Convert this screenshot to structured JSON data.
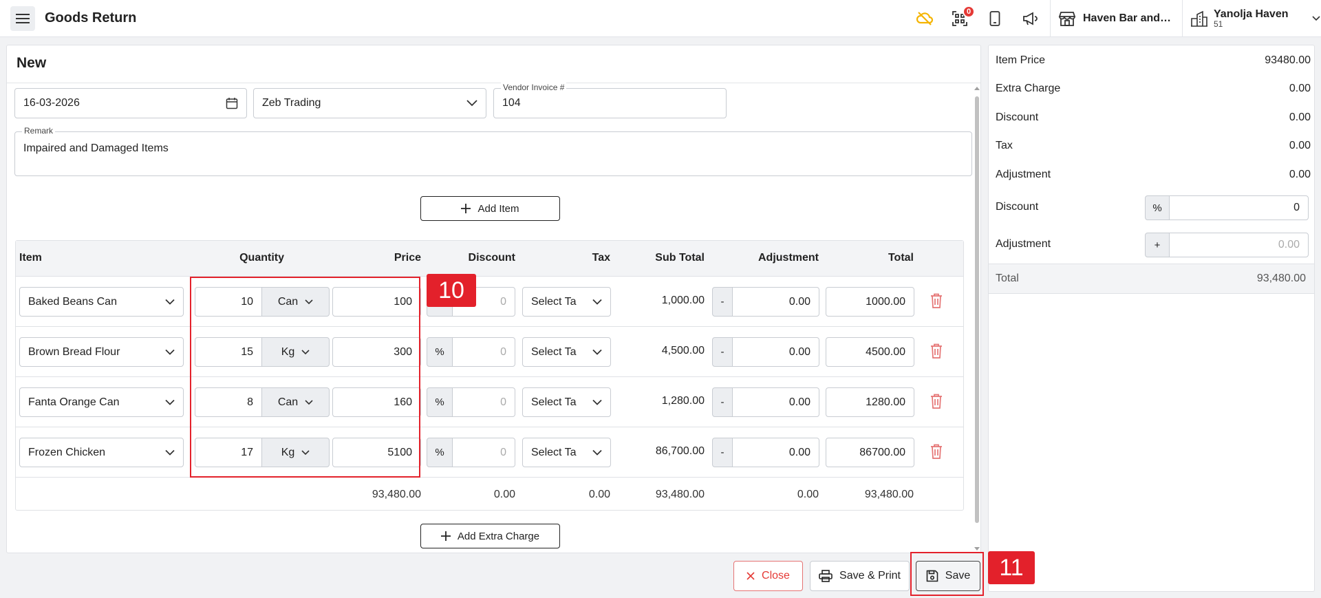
{
  "header": {
    "title": "Goods Return",
    "notification_count": "0",
    "venue_name": "Haven Bar and Restaurant",
    "company_name": "Yanolja Haven",
    "company_id": "51"
  },
  "form": {
    "title": "New",
    "date": "16-03-2026",
    "vendor": "Zeb Trading",
    "vendor_invoice_label": "Vendor Invoice #",
    "vendor_invoice": "104",
    "remark_label": "Remark",
    "remark": "Impaired and Damaged Items",
    "add_item_label": "Add Item",
    "add_extra_charge_label": "Add Extra Charge"
  },
  "table": {
    "headers": {
      "item": "Item",
      "quantity": "Quantity",
      "price": "Price",
      "discount": "Discount",
      "tax": "Tax",
      "sub_total": "Sub Total",
      "adjustment": "Adjustment",
      "total": "Total"
    },
    "rows": [
      {
        "item": "Baked Beans Can",
        "qty": "10",
        "unit": "Can",
        "price": "100",
        "disc_type": "%",
        "discount": "0",
        "tax": "Select Tax",
        "sub_total": "1,000.00",
        "adj_type": "-",
        "adjustment": "0.00",
        "total": "1000.00"
      },
      {
        "item": "Brown Bread Flour",
        "qty": "15",
        "unit": "Kg",
        "price": "300",
        "disc_type": "%",
        "discount": "0",
        "tax": "Select Tax",
        "sub_total": "4,500.00",
        "adj_type": "-",
        "adjustment": "0.00",
        "total": "4500.00"
      },
      {
        "item": "Fanta Orange Can",
        "qty": "8",
        "unit": "Can",
        "price": "160",
        "disc_type": "%",
        "discount": "0",
        "tax": "Select Tax",
        "sub_total": "1,280.00",
        "adj_type": "-",
        "adjustment": "0.00",
        "total": "1280.00"
      },
      {
        "item": "Frozen Chicken",
        "qty": "17",
        "unit": "Kg",
        "price": "5100",
        "disc_type": "%",
        "discount": "0",
        "tax": "Select Tax",
        "sub_total": "86,700.00",
        "adj_type": "-",
        "adjustment": "0.00",
        "total": "86700.00"
      }
    ],
    "footer": {
      "price": "93,480.00",
      "discount": "0.00",
      "tax": "0.00",
      "sub_total": "93,480.00",
      "adjustment": "0.00",
      "total": "93,480.00"
    }
  },
  "summary": {
    "item_price_label": "Item Price",
    "item_price": "93480.00",
    "extra_charge_label": "Extra Charge",
    "extra_charge": "0.00",
    "discount_label": "Discount",
    "discount": "0.00",
    "tax_label": "Tax",
    "tax": "0.00",
    "adjustment_label": "Adjustment",
    "adjustment": "0.00",
    "discount_input_label": "Discount",
    "discount_type": "%",
    "discount_input": "0",
    "adjustment_input_label": "Adjustment",
    "adjustment_type": "+",
    "adjustment_placeholder": "0.00",
    "total_label": "Total",
    "total": "93,480.00"
  },
  "actions": {
    "close_label": "Close",
    "save_print_label": "Save & Print",
    "save_label": "Save"
  },
  "annotations": {
    "quantity_price_tag": "10",
    "save_tag": "11"
  }
}
